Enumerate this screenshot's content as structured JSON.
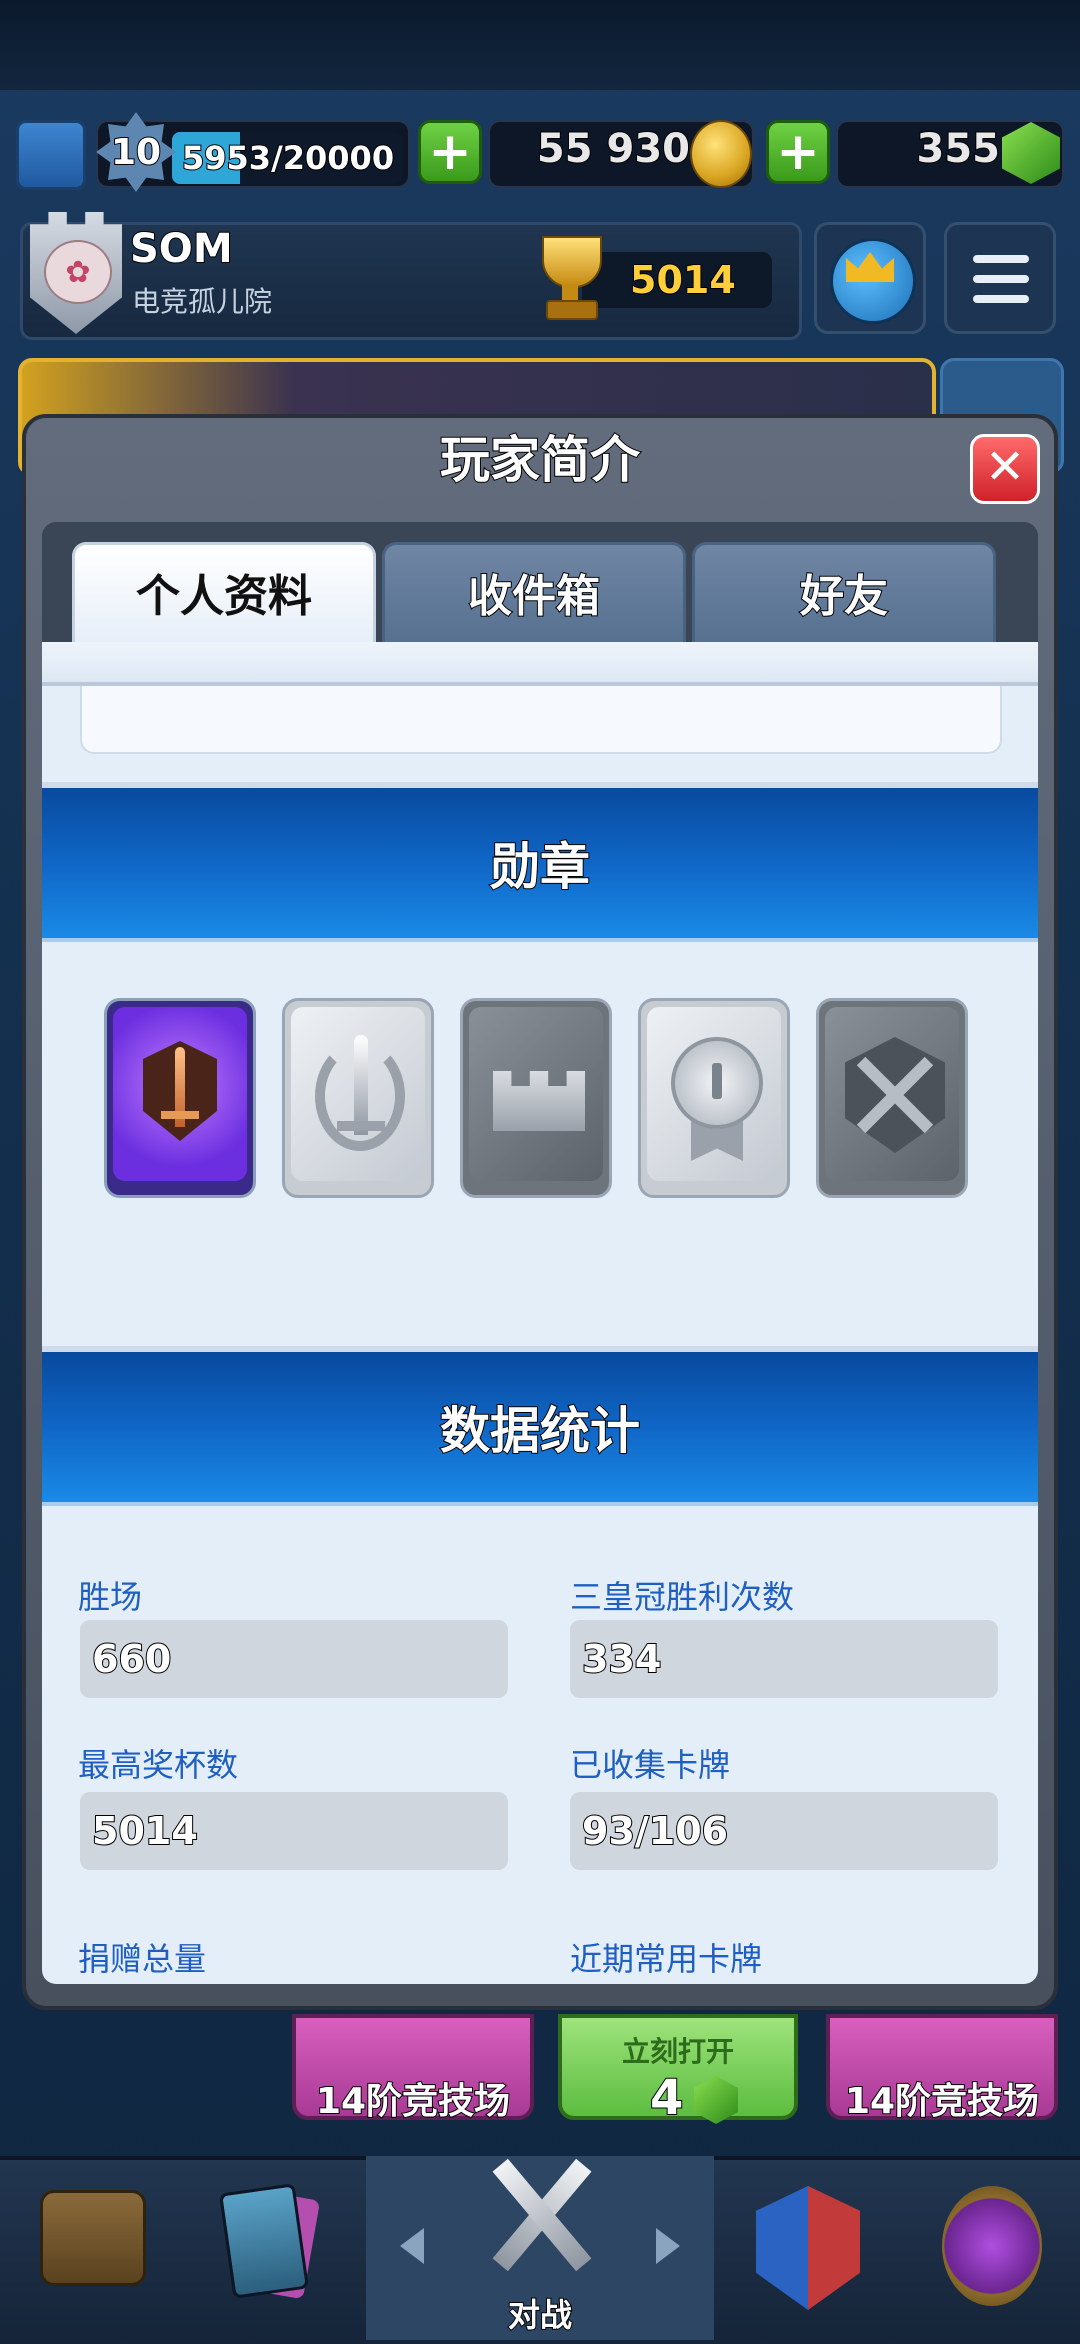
{
  "top_bar": {
    "level": "10",
    "xp": "5953/20000",
    "xp_progress": 0.2977,
    "gold": "55 930",
    "gems": "355"
  },
  "player": {
    "name": "SOM",
    "clan": "电竞孤儿院",
    "trophies": "5014"
  },
  "modal": {
    "title": "玩家简介",
    "close_symbol": "✕",
    "tabs": [
      {
        "label": "个人资料",
        "active": true
      },
      {
        "label": "收件箱",
        "active": false
      },
      {
        "label": "好友",
        "active": false
      }
    ],
    "badges_header": "勋章",
    "badges": [
      {
        "icon": "copper-sword-badge-icon",
        "color": "#7a3ff0"
      },
      {
        "icon": "laurel-sword-badge-icon",
        "color": "#d8dde3"
      },
      {
        "icon": "crown-badge-icon",
        "color": "#8d939a"
      },
      {
        "icon": "silver-medal-badge-icon",
        "color": "#d8dde3"
      },
      {
        "icon": "crossed-swords-badge-icon",
        "color": "#8d939a"
      }
    ],
    "stats_header": "数据统计",
    "stats": [
      {
        "label": "胜场",
        "value": "660"
      },
      {
        "label": "三皇冠胜利次数",
        "value": "334"
      },
      {
        "label": "最高奖杯数",
        "value": "5014"
      },
      {
        "label": "已收集卡牌",
        "value": "93/106"
      },
      {
        "label": "捐赠总量",
        "value": ""
      },
      {
        "label": "近期常用卡牌",
        "value": ""
      }
    ]
  },
  "chests": [
    {
      "label": "14阶竞技场"
    },
    {
      "label": "立刻打开",
      "cost": "4"
    },
    {
      "label": "14阶竞技场"
    }
  ],
  "nav": {
    "battle_label": "对战"
  },
  "colors": {
    "accent_blue": "#1f5fc2",
    "trophy_gold": "#ffcf3b",
    "close_red": "#d0212b"
  }
}
